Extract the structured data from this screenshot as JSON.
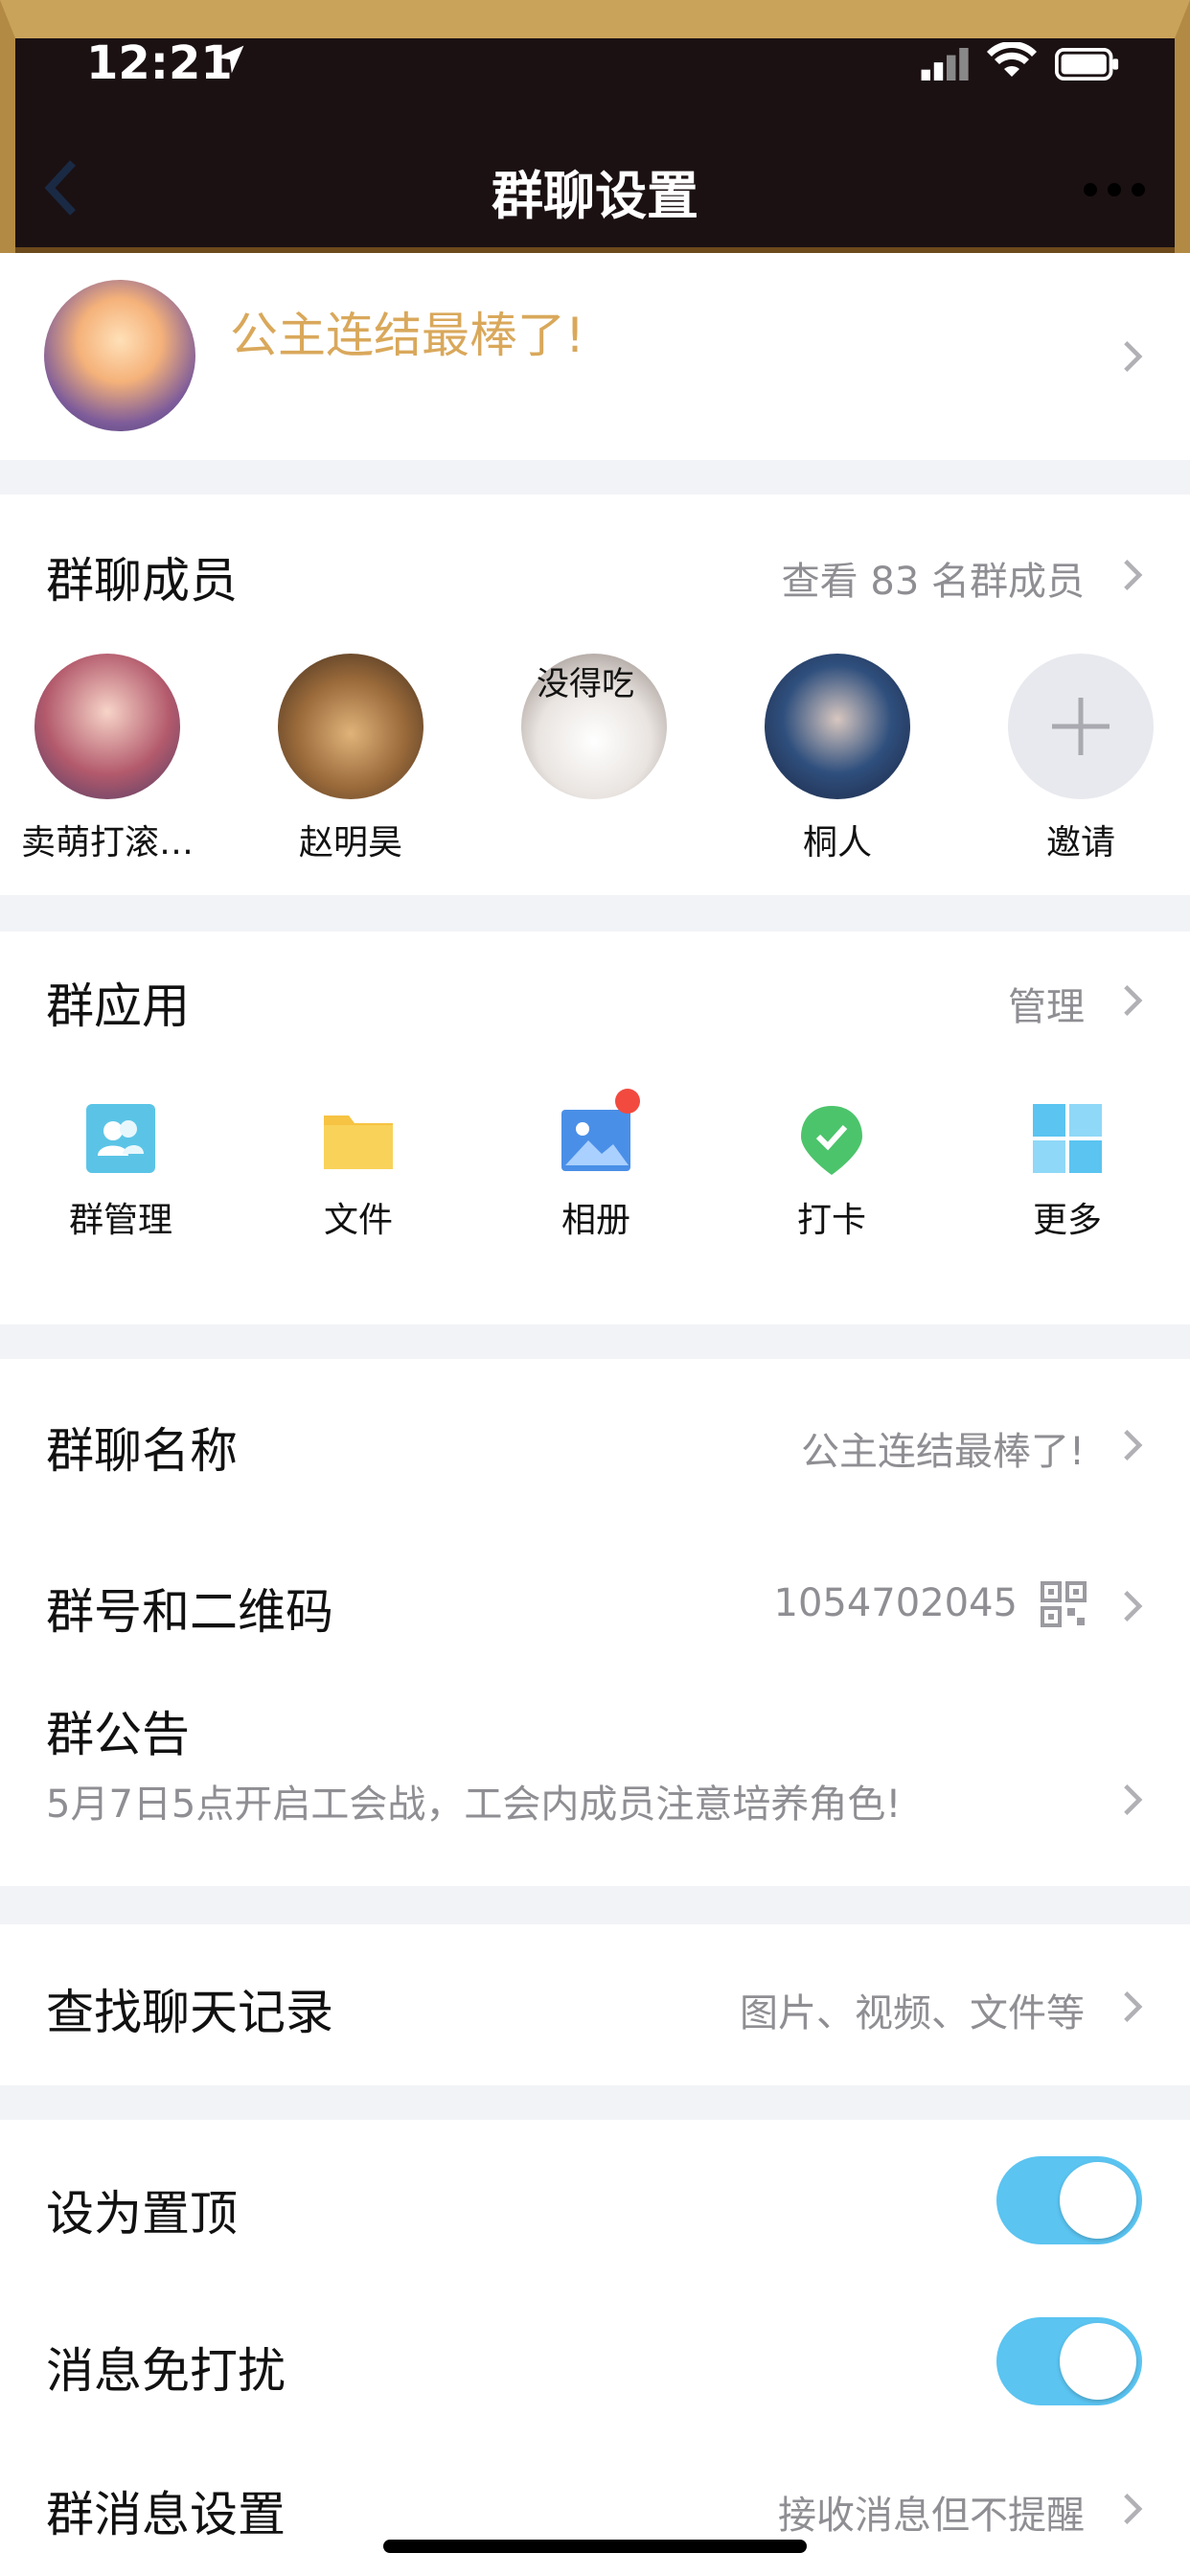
{
  "status_bar": {
    "time": "12:21"
  },
  "header": {
    "title": "群聊设置"
  },
  "group": {
    "name": "公主连结最棒了!"
  },
  "members": {
    "title": "群聊成员",
    "view_all": "查看 83 名群成员",
    "list": [
      {
        "name": "卖萌打滚…",
        "avatar_color": "#b35a6c"
      },
      {
        "name": "赵明昊",
        "avatar_color": "#9a6a3a"
      },
      {
        "name": "没得吃",
        "avatar_color": "#e9e4e0"
      },
      {
        "name": "桐人",
        "avatar_color": "#2f4f7d"
      }
    ],
    "invite_label": "邀请"
  },
  "apps": {
    "title": "群应用",
    "manage": "管理",
    "items": [
      {
        "label": "群管理",
        "icon": "group-manage-icon"
      },
      {
        "label": "文件",
        "icon": "folder-icon"
      },
      {
        "label": "相册",
        "icon": "album-icon"
      },
      {
        "label": "打卡",
        "icon": "checkin-icon"
      },
      {
        "label": "更多",
        "icon": "grid-more-icon"
      }
    ]
  },
  "info": {
    "name_label": "群聊名称",
    "name_value": "公主连结最棒了!",
    "id_label": "群号和二维码",
    "id_value": "1054702045",
    "notice_label": "群公告",
    "notice_text": "5月7日5点开启工会战，工会内成员注意培养角色!"
  },
  "search": {
    "label": "查找聊天记录",
    "hint": "图片、视频、文件等"
  },
  "settings": {
    "pin_label": "设为置顶",
    "pin_on": true,
    "mute_label": "消息免打扰",
    "mute_on": true,
    "msg_label": "群消息设置",
    "msg_value": "接收消息但不提醒"
  },
  "colors": {
    "accent": "#5bc4f1",
    "group_name": "#d9a85b",
    "secondary_text": "#8e8e93"
  }
}
